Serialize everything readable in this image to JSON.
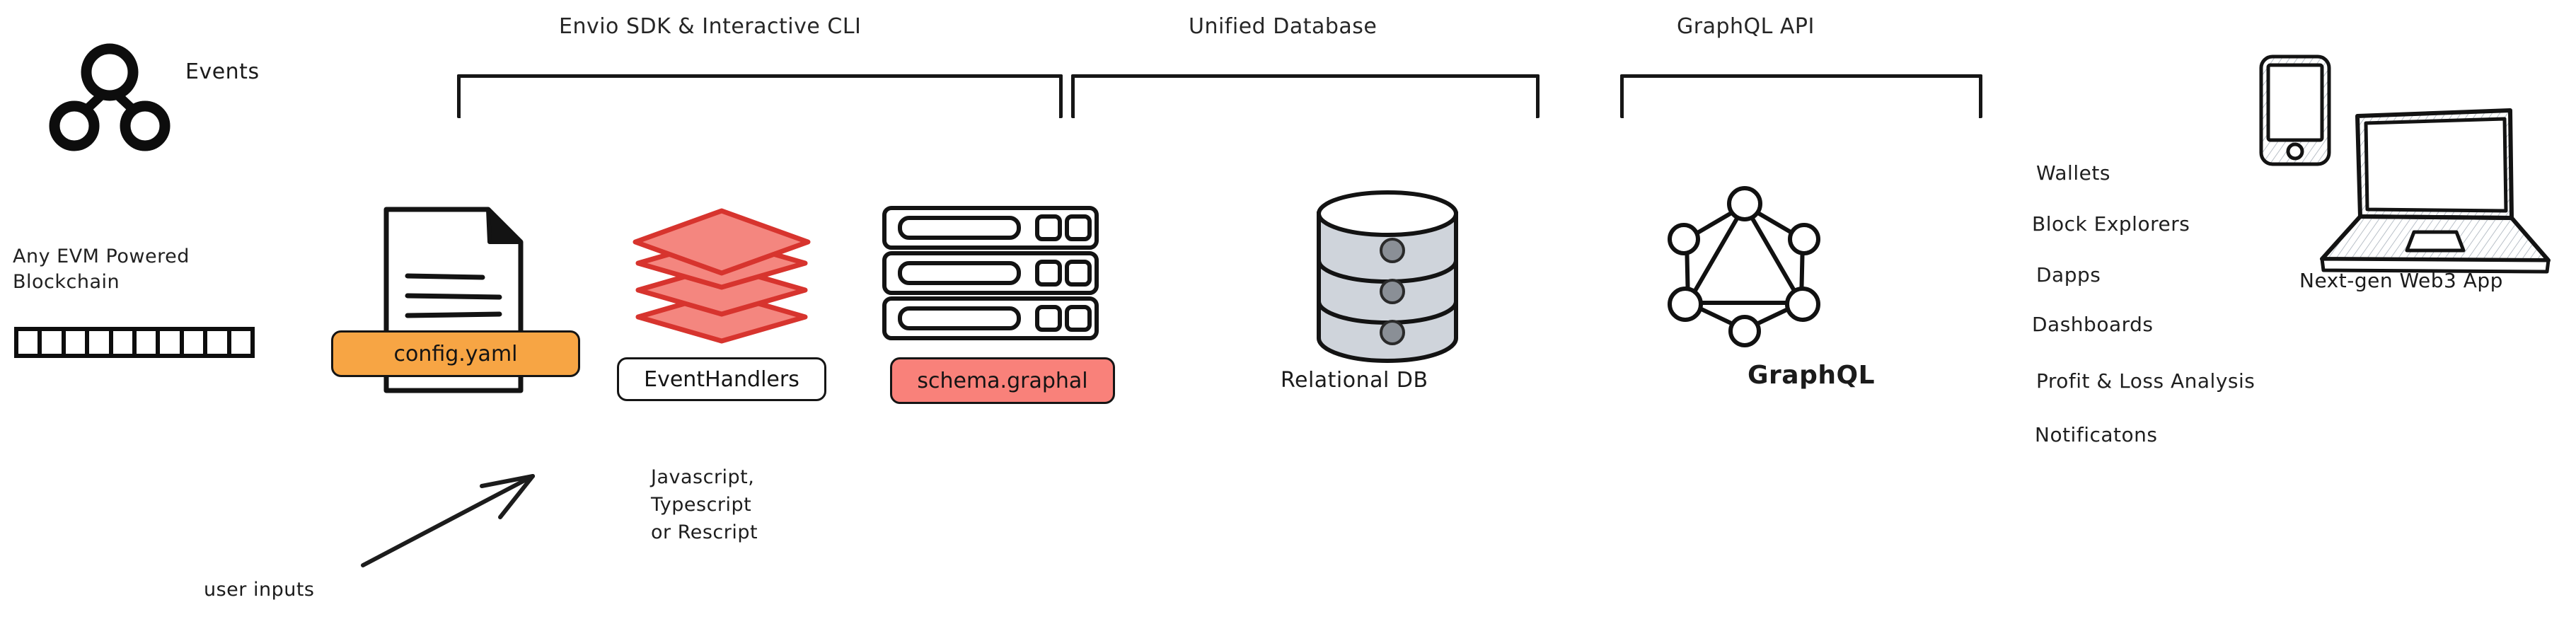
{
  "diagram": {
    "title": "Envio indexing architecture",
    "background": "#ffffff",
    "colors": {
      "ink": "#161616",
      "orange": "#F7A544",
      "salmon": "#F9817A",
      "layer_red_fill": "#F4867F",
      "layer_red_stroke": "#D7342E",
      "db_fill": "#CFD4DB",
      "db_dot": "#8A8F96",
      "hatch": "#B9C0C8"
    }
  },
  "groups": [
    {
      "id": "sdk",
      "label": "Envio SDK & Interactive CLI"
    },
    {
      "id": "db",
      "label": "Unified Database"
    },
    {
      "id": "api",
      "label": "GraphQL API"
    }
  ],
  "source": {
    "events_label": "Events",
    "events_icon": "event-tree-icon",
    "blockchain_label": "Any EVM Powered\nBlockchain",
    "blockchain_icon": "blockchain-strip-icon",
    "blockchain_blocks": 10
  },
  "sdk": {
    "config": {
      "icon": "document-icon",
      "pill_label": "config.yaml",
      "pill_color": "#F7A544"
    },
    "handlers": {
      "icon": "layers-stack-icon",
      "pill_label": "EventHandlers",
      "pill_color": "#ffffff",
      "languages": "Javascript,\nTypescript\nor Rescript"
    },
    "schema": {
      "icon": "server-rack-icon",
      "pill_label": "schema.graphal",
      "pill_color": "#F9817A"
    },
    "annotation": {
      "label": "user inputs",
      "icon": "arrow-up-right-icon"
    }
  },
  "database": {
    "icon": "database-cylinder-icon",
    "caption": "Relational DB"
  },
  "api": {
    "icon": "graphql-logo-icon",
    "caption": "GraphQL"
  },
  "consumers": {
    "items": [
      "Wallets",
      "Block Explorers",
      "Dapps",
      "Dashboards",
      "Profit & Loss Analysis",
      "Notificatons"
    ],
    "devices_icon": "phone-and-laptop-icon",
    "devices_caption": "Next-gen Web3 App"
  }
}
